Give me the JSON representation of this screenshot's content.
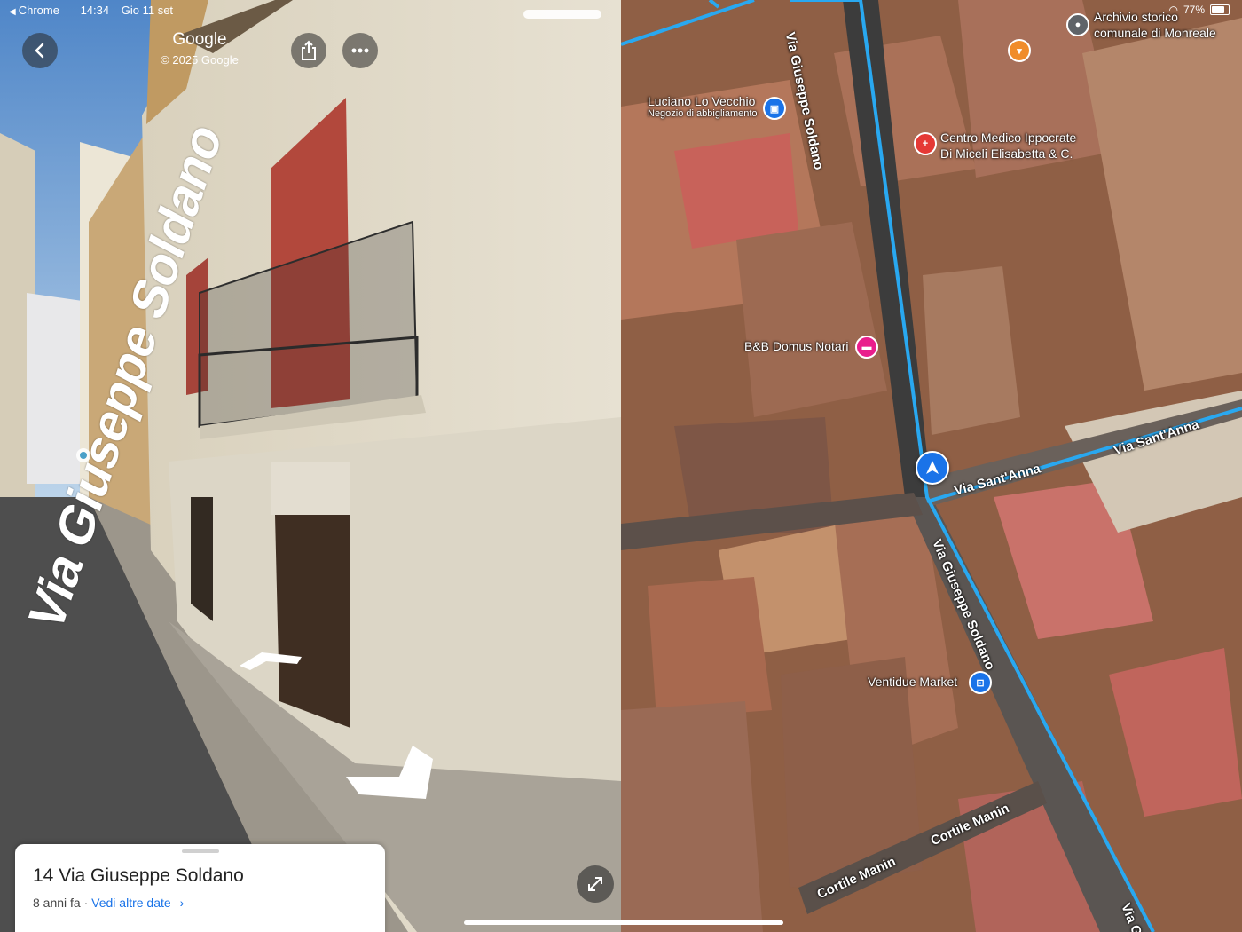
{
  "status_bar": {
    "back_app": "Chrome",
    "time": "14:34",
    "date": "Gio 11 set",
    "battery": "77%"
  },
  "street_view": {
    "title": "Google",
    "copyright": "© 2025 Google",
    "road_label": "Via Giuseppe Soldano",
    "card": {
      "address": "14 Via Giuseppe Soldano",
      "age": "8 anni fa",
      "separator": "·",
      "link": "Vedi altre date"
    },
    "icons": [
      "back-icon",
      "share-icon",
      "more-icon",
      "expand-icon"
    ]
  },
  "map": {
    "places": [
      {
        "name": "Archivio storico comunale di Monreale",
        "line1": "Archivio storico",
        "line2": "comunale di Monreale",
        "color": "#5f6368"
      },
      {
        "name": "Luciano Lo Vecchio",
        "subtitle": "Negozio di abbigliamento",
        "color": "#1a73e8"
      },
      {
        "name": "Centro Medico Ippocrate",
        "line2": "Di Miceli Elisabetta & C.",
        "color": "#e53935"
      },
      {
        "name": "B&B Domus Notari",
        "color": "#e91e8c"
      },
      {
        "name": "Ventidue Market",
        "color": "#1a73e8"
      }
    ],
    "streets": {
      "soldano_north": "Via Giuseppe Soldano",
      "soldano_south": "Via Giuseppe Soldano",
      "santanna_1": "Via Sant'Anna",
      "santanna_2": "Via Sant'Anna",
      "manin_1": "Cortile Manin",
      "manin_2": "Cortile Manin",
      "partial": "Via Gi"
    },
    "accent": "#1a73e8",
    "route_color": "#29a8f0"
  }
}
